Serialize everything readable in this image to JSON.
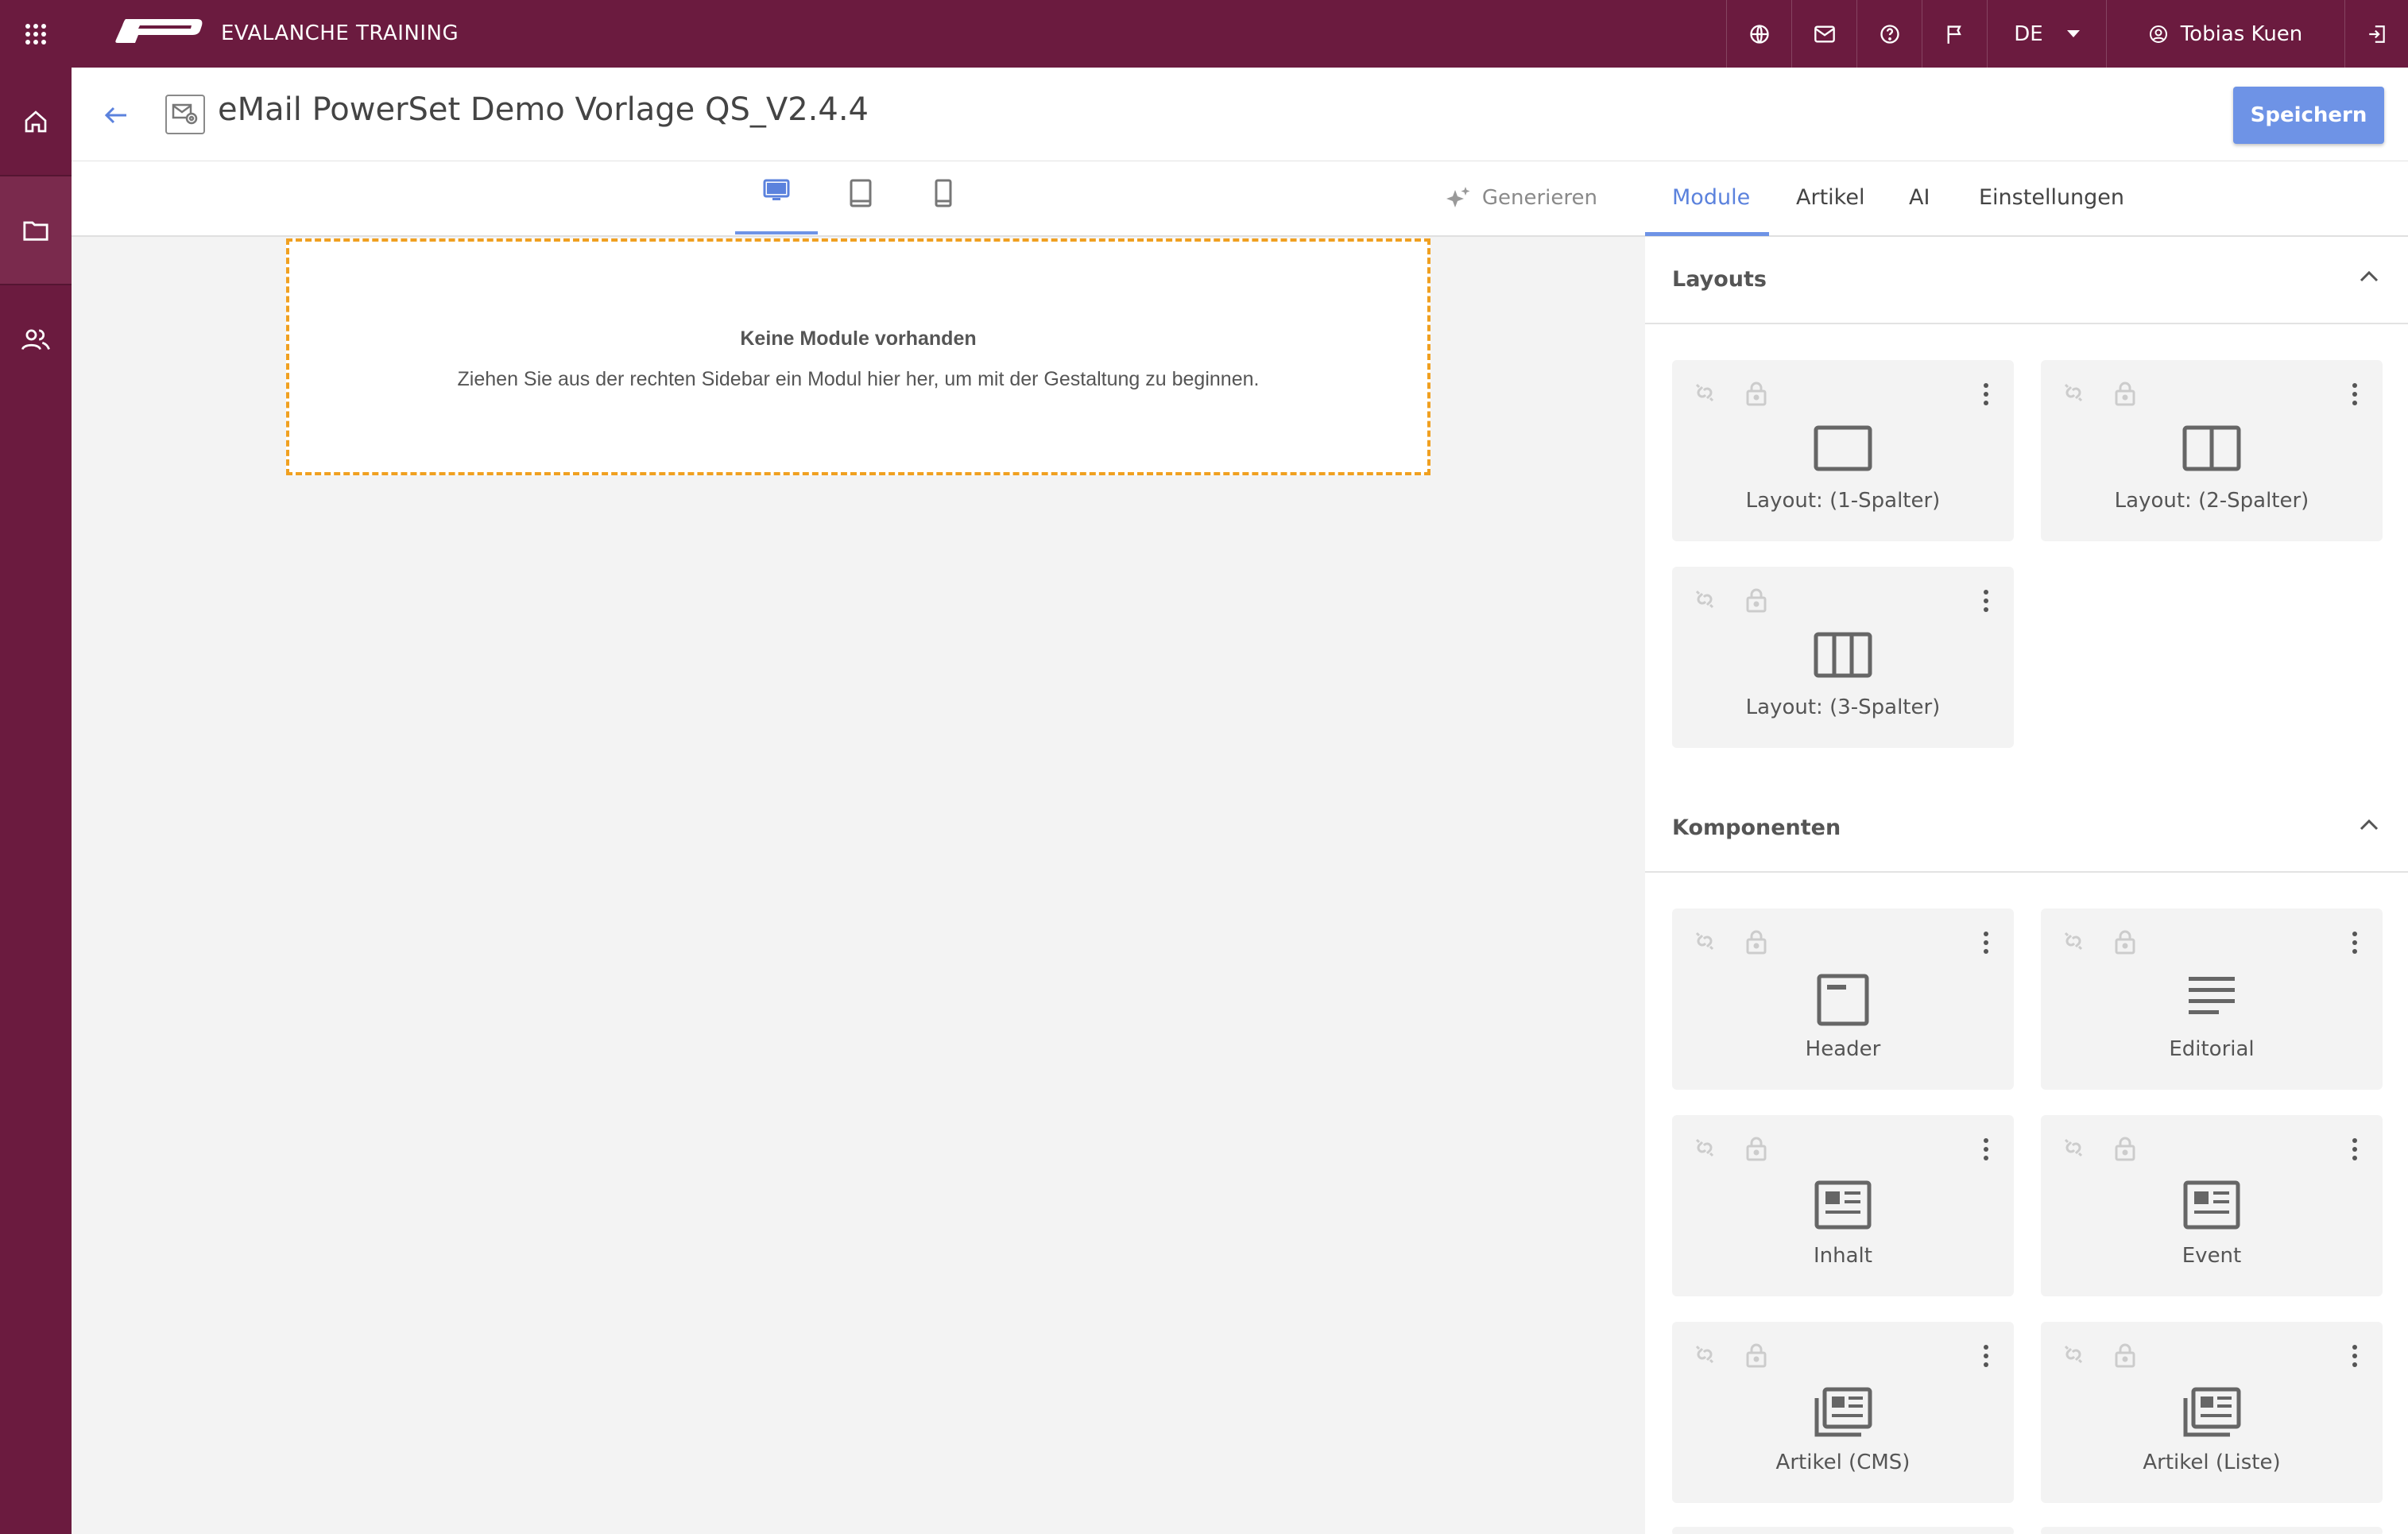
{
  "topbar": {
    "brand": "EVALANCHE TRAINING",
    "language": "DE",
    "user": "Tobias Kuen"
  },
  "header": {
    "title": "eMail PowerSet Demo Vorlage QS_V2.4.4",
    "save_label": "Speichern"
  },
  "toolbar": {
    "generate_label": "Generieren"
  },
  "canvas": {
    "empty_title": "Keine Module vorhanden",
    "empty_desc": "Ziehen Sie aus der rechten Sidebar ein Modul hier her, um mit der Gestaltung zu beginnen."
  },
  "sidebar": {
    "tabs": [
      "Module",
      "Artikel",
      "AI",
      "Einstellungen"
    ],
    "sections": [
      {
        "title": "Layouts",
        "items": [
          {
            "label": "Layout: (1-Spalter)",
            "icon": "layout-1col-icon"
          },
          {
            "label": "Layout: (2-Spalter)",
            "icon": "layout-2col-icon"
          },
          {
            "label": "Layout: (3-Spalter)",
            "icon": "layout-3col-icon"
          }
        ]
      },
      {
        "title": "Komponenten",
        "items": [
          {
            "label": "Header",
            "icon": "header-icon"
          },
          {
            "label": "Editorial",
            "icon": "editorial-icon"
          },
          {
            "label": "Inhalt",
            "icon": "article-icon"
          },
          {
            "label": "Event",
            "icon": "article-icon"
          },
          {
            "label": "Artikel (CMS)",
            "icon": "article-stack-icon"
          },
          {
            "label": "Artikel (Liste)",
            "icon": "article-stack-icon"
          }
        ]
      }
    ]
  },
  "colors": {
    "brand": "#6b1b3f",
    "accent": "#6e93e6",
    "dropzone_border": "#f0a020"
  }
}
